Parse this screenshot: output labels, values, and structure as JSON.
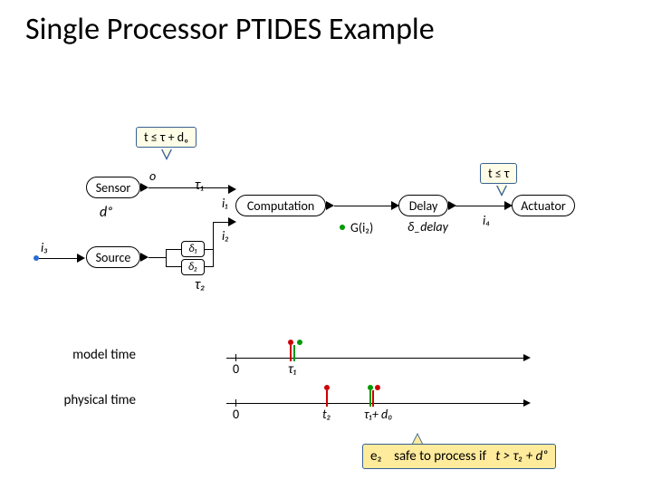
{
  "title": "Single Processor PTIDES Example",
  "callouts": {
    "sensor": "t ≤ τ + dₒ",
    "actuator": "t ≤ τ"
  },
  "labels": {
    "d_o": "dₒ",
    "tau1": "τ₁",
    "tau2": "τ₂",
    "i3": "i₃",
    "i4": "i₄",
    "delta1": "δ₁",
    "delta2": "δ₂",
    "o": "o",
    "i1": "i₁",
    "i2": "i₂",
    "Gi2": "G(i₂)",
    "delta_delay": "δ_delay"
  },
  "boxes": {
    "sensor": "Sensor",
    "source": "Source",
    "computation": "Computation",
    "delay": "Delay",
    "actuator": "Actuator"
  },
  "timelines": {
    "model": "model time",
    "physical": "physical time",
    "zero": "0",
    "tau1": "τ₁",
    "t2": "t₂",
    "tau1_d0": "τ₁+ d₀"
  },
  "safe": {
    "prefix": "e₂",
    "text": "safe to process if",
    "cond": "t > τ₂ + dₒ"
  }
}
